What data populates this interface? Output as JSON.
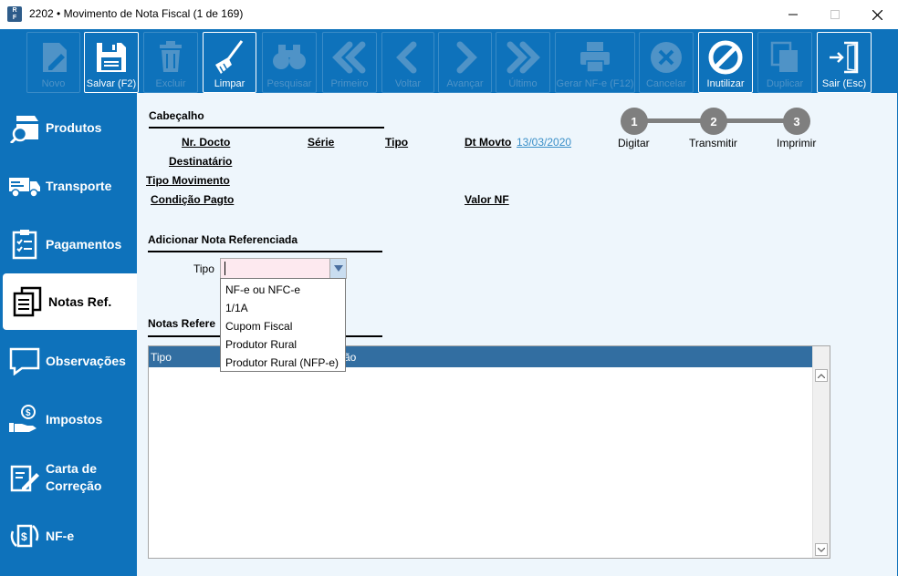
{
  "window": {
    "title": "2202 • Movimento de Nota Fiscal (1 de 169)",
    "app_icon": "RF app icon",
    "controls": [
      "minimize-icon",
      "maximize-icon",
      "close-icon"
    ]
  },
  "toolbar": {
    "buttons": [
      {
        "label": "Novo",
        "icon": "edit-document-icon",
        "enabled": false
      },
      {
        "label": "Salvar (F2)",
        "icon": "floppy-disk-icon",
        "enabled": true
      },
      {
        "label": "Excluir",
        "icon": "trash-icon",
        "enabled": false
      },
      {
        "label": "Limpar",
        "icon": "broom-icon",
        "enabled": true
      },
      {
        "label": "Pesquisar",
        "icon": "binoculars-icon",
        "enabled": false
      },
      {
        "label": "Primeiro",
        "icon": "double-chevron-left-icon",
        "enabled": false
      },
      {
        "label": "Voltar",
        "icon": "chevron-left-icon",
        "enabled": false
      },
      {
        "label": "Avançar",
        "icon": "chevron-right-icon",
        "enabled": false
      },
      {
        "label": "Último",
        "icon": "double-chevron-right-icon",
        "enabled": false
      },
      {
        "label": "Gerar NF-e (F12)",
        "icon": "printer-icon",
        "enabled": false
      },
      {
        "label": "Cancelar",
        "icon": "cancel-circle-icon",
        "enabled": false
      },
      {
        "label": "Inutilizar",
        "icon": "prohibited-icon",
        "enabled": true
      },
      {
        "label": "Duplicar",
        "icon": "copy-icon",
        "enabled": false
      },
      {
        "label": "Sair (Esc)",
        "icon": "exit-door-icon",
        "enabled": true
      }
    ]
  },
  "sidebar": {
    "items": [
      {
        "label": "Produtos",
        "icon": "box-search-icon"
      },
      {
        "label": "Transporte",
        "icon": "truck-icon"
      },
      {
        "label": "Pagamentos",
        "icon": "clipboard-checklist-icon"
      },
      {
        "label": "Notas Ref.",
        "icon": "documents-icon",
        "active": true
      },
      {
        "label": "Observações",
        "icon": "speech-bubble-icon"
      },
      {
        "label": "Impostos",
        "icon": "hand-coin-icon"
      },
      {
        "label": "Carta de Correção",
        "icon": "document-pen-icon"
      },
      {
        "label": "NF-e",
        "icon": "nfe-exchange-icon"
      }
    ]
  },
  "header": {
    "section_title": "Cabeçalho",
    "nr_docto_label": "Nr. Docto",
    "serie_label": "Série",
    "tipo_label": "Tipo",
    "dt_movto_label": "Dt Movto",
    "dt_movto_value": "13/03/2020",
    "destinatario_label": "Destinatário",
    "tipo_movimento_label": "Tipo Movimento",
    "condicao_pagto_label": "Condição Pagto",
    "valor_nf_label": "Valor NF"
  },
  "steps": [
    {
      "number": "1",
      "label": "Digitar"
    },
    {
      "number": "2",
      "label": "Transmitir"
    },
    {
      "number": "3",
      "label": "Imprimir"
    }
  ],
  "add_ref": {
    "section_title": "Adicionar Nota Referenciada",
    "tipo_label": "Tipo",
    "tipo_value": "",
    "options": [
      "NF-e ou NFC-e",
      "1/1A",
      "Cupom Fiscal",
      "Produtor Rural",
      "Produtor Rural (NFP-e)"
    ]
  },
  "notas": {
    "section_title_visible": "Notas Refere",
    "columns_visible": [
      "Tipo",
      "ão"
    ],
    "rows": []
  },
  "colors": {
    "brand_blue": "#0e72bb",
    "content_bg": "#eef6fc",
    "grid_header": "#326ea1",
    "step_gray": "#7f7f7f",
    "date_link": "#3a8fc8"
  }
}
